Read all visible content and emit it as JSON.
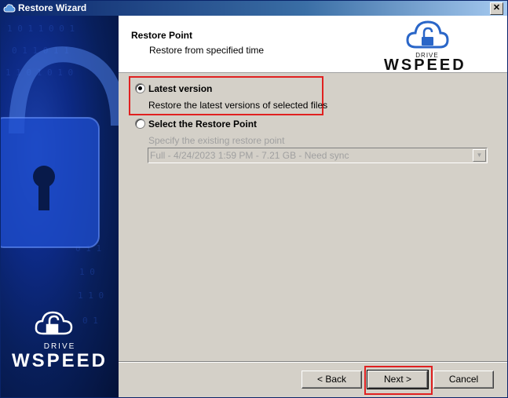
{
  "window": {
    "title": "Restore Wizard",
    "close_glyph": "✕"
  },
  "header": {
    "title": "Restore Point",
    "subtitle": "Restore from specified time",
    "logo_drive": "DRIVE",
    "logo_wspeed": "WSPEED"
  },
  "banner": {
    "brand_drive": "DRIVE",
    "brand_wspeed": "WSPEED"
  },
  "options": {
    "latest": {
      "label": "Latest version",
      "description": "Restore the latest versions of selected files",
      "selected": true
    },
    "restore_point": {
      "label": "Select the Restore Point",
      "description": "Specify the existing restore point",
      "selected": false,
      "combo_value": "Full - 4/24/2023 1:59 PM - 7.21 GB - Need sync"
    }
  },
  "buttons": {
    "back": "< Back",
    "next": "Next >",
    "cancel": "Cancel"
  },
  "colors": {
    "highlight": "#e02020",
    "titlebar_start": "#0a246a",
    "banner_blue": "#0d2a86"
  }
}
